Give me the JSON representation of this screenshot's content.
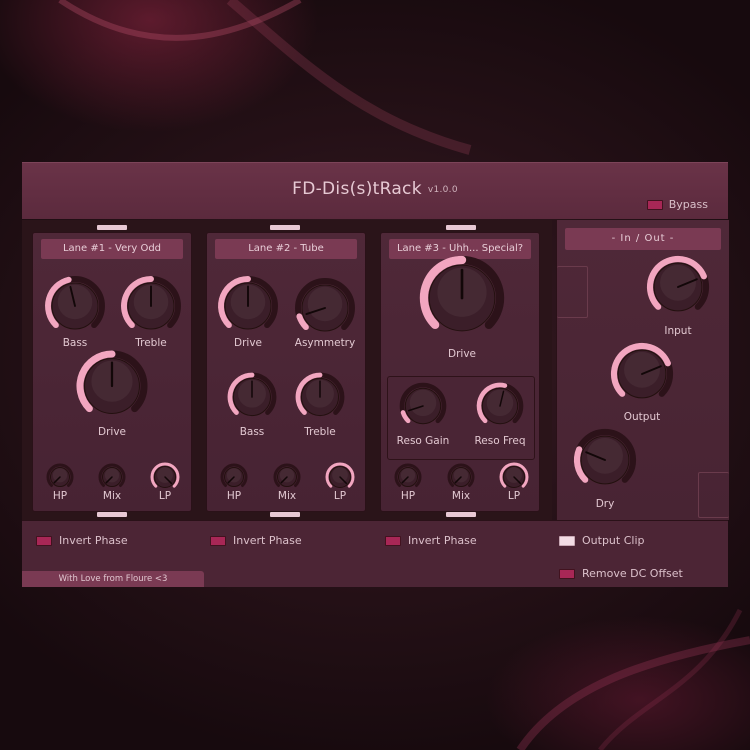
{
  "app": {
    "title": "FD-Dis(s)tRack",
    "version": "v1.0.0",
    "bypass_label": "Bypass"
  },
  "colors": {
    "accent": "#f2a6c0",
    "panel": "#4f2838",
    "header": "#7a3a53",
    "led_off": "#a82756",
    "led_on": "#f2dce4"
  },
  "lanes": [
    {
      "header": "Lane #1 - Very Odd",
      "knobs": {
        "bass": "Bass",
        "treble": "Treble",
        "drive": "Drive",
        "hp": "HP",
        "mix": "Mix",
        "lp": "LP"
      },
      "invert_phase": "Invert Phase"
    },
    {
      "header": "Lane #2 - Tube",
      "knobs": {
        "drive": "Drive",
        "asymmetry": "Asymmetry",
        "bass": "Bass",
        "treble": "Treble",
        "hp": "HP",
        "mix": "Mix",
        "lp": "LP"
      },
      "invert_phase": "Invert Phase"
    },
    {
      "header": "Lane #3 - Uhh... Special?",
      "knobs": {
        "drive": "Drive",
        "reso_gain": "Reso Gain",
        "reso_freq": "Reso Freq",
        "hp": "HP",
        "mix": "Mix",
        "lp": "LP"
      },
      "invert_phase": "Invert Phase"
    }
  ],
  "io": {
    "header": "- In / Out -",
    "input": "Input",
    "output": "Output",
    "dry": "Dry",
    "output_clip": "Output Clip",
    "remove_dc": "Remove DC Offset"
  },
  "knob_values": {
    "l1_bass": 0.45,
    "l1_treble": 0.5,
    "l1_drive": 0.5,
    "l1_hp": 0.0,
    "l1_mix": 0.0,
    "l1_lp": 1.0,
    "l2_drive": 0.5,
    "l2_asym": 0.1,
    "l2_bass": 0.5,
    "l2_treble": 0.5,
    "l2_hp": 0.0,
    "l2_mix": 0.0,
    "l2_lp": 1.0,
    "l3_drive": 0.5,
    "l3_reso_gain": 0.1,
    "l3_reso_freq": 0.55,
    "l3_hp": 0.0,
    "l3_mix": 0.0,
    "l3_lp": 1.0,
    "input": 0.75,
    "output": 0.75,
    "dry": 0.25
  },
  "credit": "With Love from Floure <3"
}
